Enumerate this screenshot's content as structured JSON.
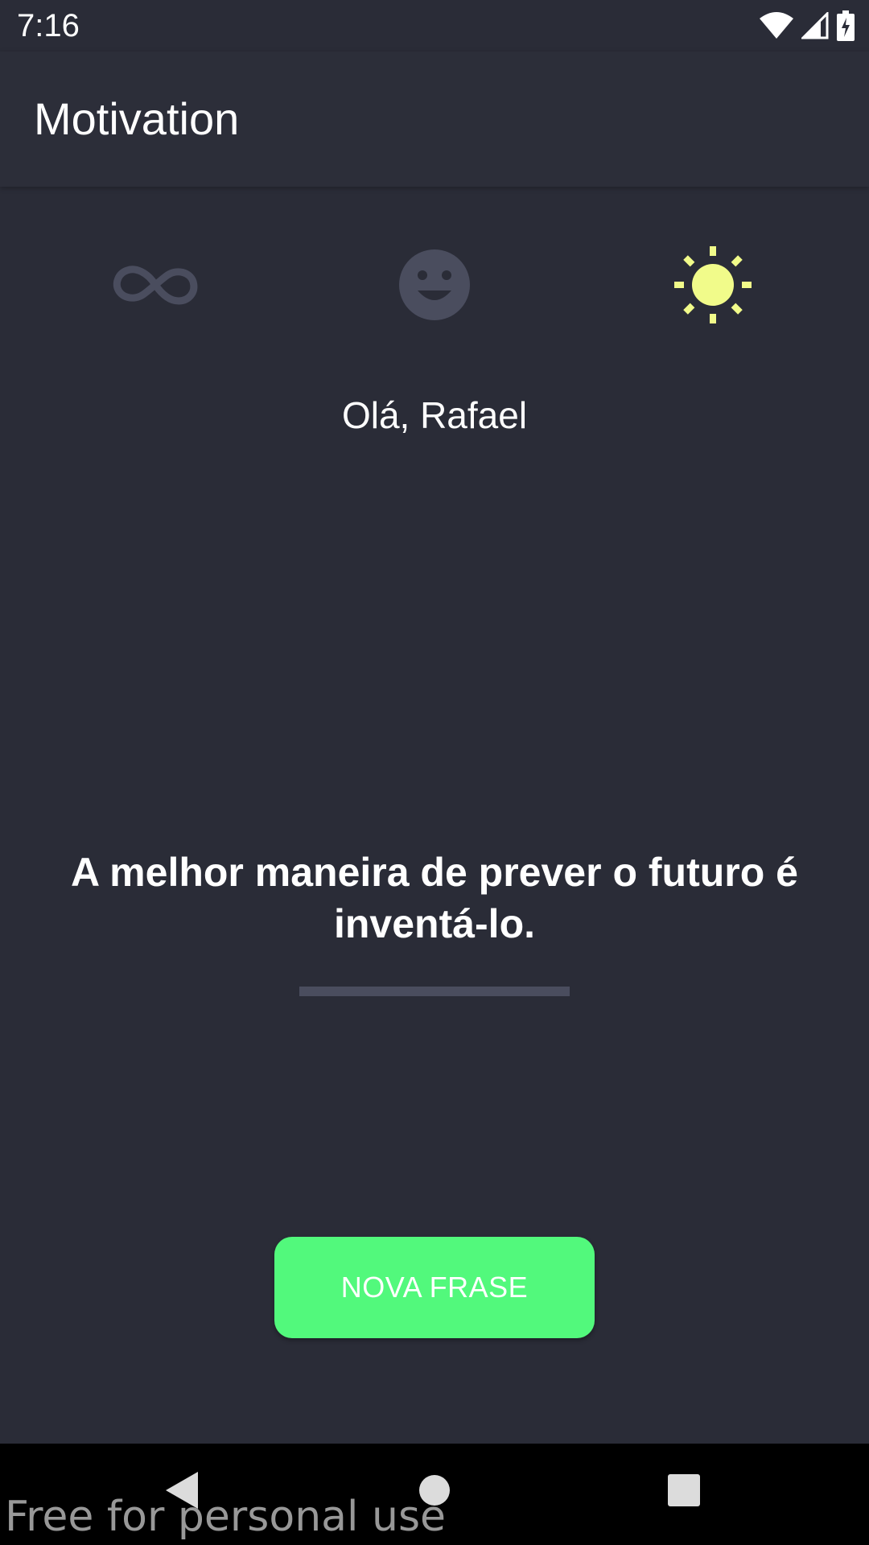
{
  "status_bar": {
    "time": "7:16",
    "icons": [
      "wifi-icon",
      "cell-signal-icon",
      "battery-charging-icon"
    ]
  },
  "app_bar": {
    "title": "Motivation"
  },
  "categories": [
    {
      "name": "infinity-icon",
      "selected": false
    },
    {
      "name": "happy-face-icon",
      "selected": false
    },
    {
      "name": "sun-icon",
      "selected": true
    }
  ],
  "colors": {
    "background": "#2a2c37",
    "icon_inactive": "#4a4d5e",
    "icon_active": "#f1fb8a",
    "button": "#52f97c"
  },
  "greeting": "Olá, Rafael",
  "phrase": "A melhor maneira de prever o futuro é inventá-lo.",
  "button": {
    "label": "NOVA FRASE"
  },
  "nav_bar": {
    "icons": [
      "back-icon",
      "home-icon",
      "recents-icon"
    ]
  },
  "watermark": "Free for personal use"
}
